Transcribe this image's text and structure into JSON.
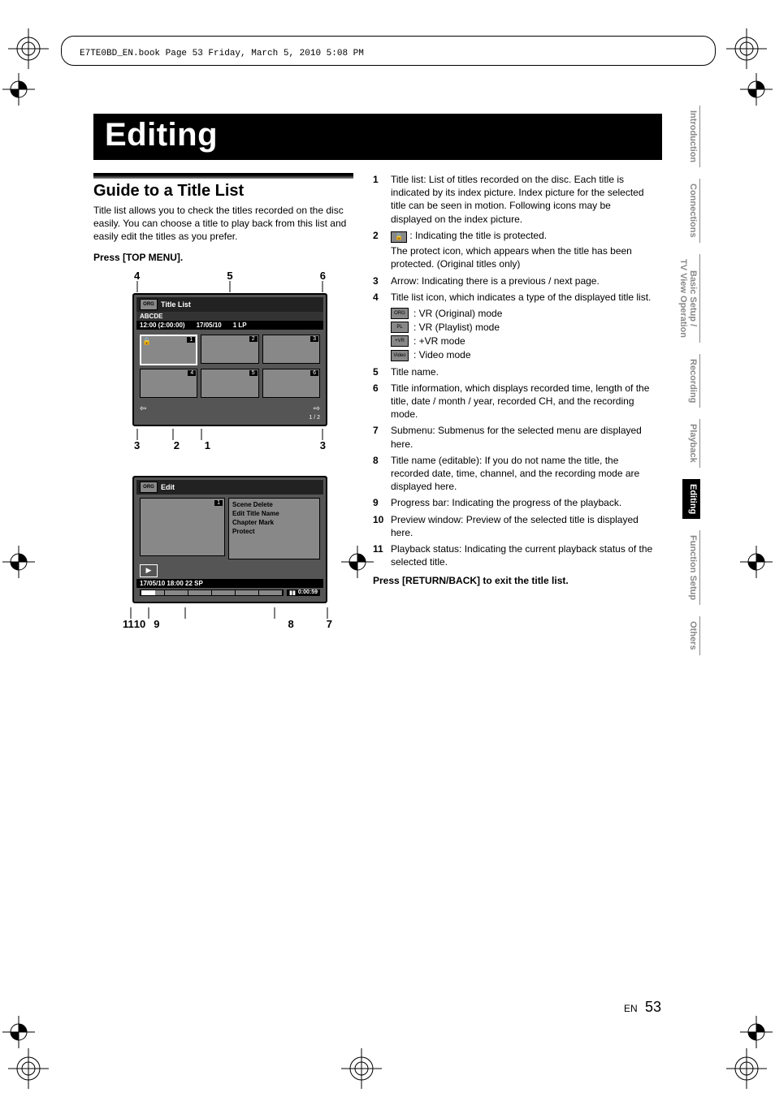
{
  "header": "E7TE0BD_EN.book  Page 53  Friday, March 5, 2010  5:08 PM",
  "chapter": "Editing",
  "section_heading": "Guide to a Title List",
  "intro": "Title list allows you to check the titles recorded on the disc easily. You can choose a title to play back from this list and easily edit the titles as you prefer.",
  "press_top_menu": "Press [TOP MENU].",
  "press_return": "Press [RETURN/BACK] to exit the title list.",
  "tabs": [
    "Introduction",
    "Connections",
    "Basic Setup /\nTV View Operation",
    "Recording",
    "Playback",
    "Editing",
    "Function Setup",
    "Others"
  ],
  "diagram1": {
    "top_callouts": [
      "4",
      "5",
      "6"
    ],
    "bottom_callouts": [
      "3",
      "2",
      "1",
      "3"
    ],
    "title": "Title List",
    "sub": "ABCDE",
    "info": [
      "12:00 (2:00:00)",
      "17/05/10",
      "1 LP"
    ],
    "thumbs": [
      "1",
      "2",
      "3",
      "4",
      "5",
      "6"
    ],
    "page": "1 / 2"
  },
  "diagram2": {
    "title": "Edit",
    "submenu": [
      "Scene Delete",
      "Edit Title Name",
      "Chapter Mark",
      "Protect"
    ],
    "title_line": "17/05/10 18:00  22  SP",
    "time": "0:00:59",
    "preview_num": "1",
    "callouts": [
      "11",
      "10",
      "9",
      "8",
      "7"
    ]
  },
  "list": [
    {
      "n": "1",
      "t": "Title list: List of titles recorded on the disc. Each title is indicated by its index picture. Index picture for the selected title can be seen in motion. Following icons may be displayed on the index picture."
    },
    {
      "n": "2",
      "t_icon": "lock",
      "t_pre": "",
      "t_post": " : Indicating the title is protected.",
      "t_extra": "The protect icon, which appears when the title has been protected. (Original titles only)"
    },
    {
      "n": "3",
      "t": "Arrow: Indicating there is a previous / next page."
    },
    {
      "n": "4",
      "t": "Title list icon, which indicates a type of the displayed title list.",
      "modes": [
        {
          "icon": "ORG",
          "label": ": VR (Original) mode"
        },
        {
          "icon": "PL",
          "label": ": VR (Playlist) mode"
        },
        {
          "icon": "+VR",
          "label": ": +VR mode"
        },
        {
          "icon": "Video",
          "label": ": Video mode"
        }
      ]
    },
    {
      "n": "5",
      "t": "Title name."
    },
    {
      "n": "6",
      "t": "Title information, which displays recorded time, length of the title, date / month / year, recorded CH, and the recording mode."
    },
    {
      "n": "7",
      "t": "Submenu: Submenus for the selected menu are displayed here."
    },
    {
      "n": "8",
      "t": "Title name (editable): If you do not name the title, the recorded date, time, channel, and the recording mode are displayed here."
    },
    {
      "n": "9",
      "t": "Progress bar: Indicating the progress of the playback."
    },
    {
      "n": "10",
      "t": "Preview window: Preview of the selected title is displayed here."
    },
    {
      "n": "11",
      "t": "Playback status: Indicating the current playback status of the selected title."
    }
  ],
  "footer": {
    "lang": "EN",
    "page": "53"
  }
}
